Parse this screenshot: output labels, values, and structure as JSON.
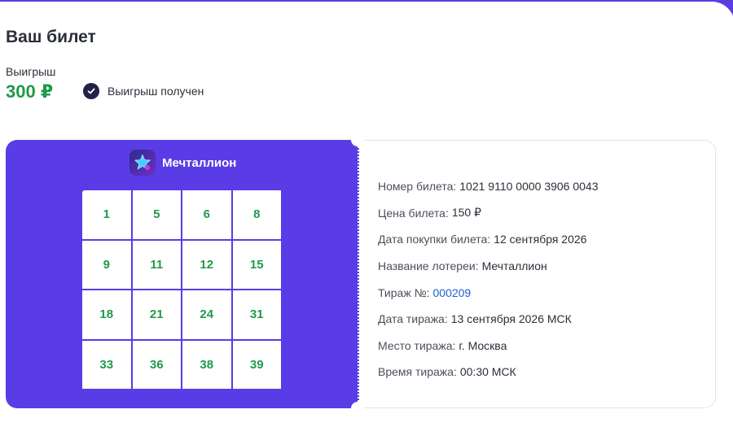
{
  "page": {
    "title": "Ваш билет"
  },
  "prize": {
    "label": "Выигрыш",
    "amount": "300 ₽",
    "status": "Выигрыш получен",
    "status_icon": "check-circle-icon"
  },
  "ticket": {
    "lottery_name": "Мечталлион",
    "logo_icon": "star-logo-icon",
    "numbers": [
      "1",
      "5",
      "6",
      "8",
      "9",
      "11",
      "12",
      "15",
      "18",
      "21",
      "24",
      "31",
      "33",
      "36",
      "38",
      "39"
    ],
    "details": [
      {
        "key": "Номер билета:",
        "value": "1021 9110 0000 3906 0043"
      },
      {
        "key": "Цена билета:",
        "value": "150 ₽"
      },
      {
        "key": "Дата покупки билета:",
        "value": "12 сентября 2026"
      },
      {
        "key": "Название лотереи:",
        "value": "Мечталлион"
      },
      {
        "key": "Тираж №:",
        "value": "000209",
        "link": true
      },
      {
        "key": "Дата тиража:",
        "value": "13 сентября 2026 МСК"
      },
      {
        "key": "Место тиража:",
        "value": "г. Москва"
      },
      {
        "key": "Время тиража:",
        "value": "00:30 МСК"
      }
    ]
  },
  "colors": {
    "accent": "#5a3ce6",
    "win_green": "#1f9a4a",
    "link": "#1f5fd1",
    "dark": "#23204a"
  }
}
